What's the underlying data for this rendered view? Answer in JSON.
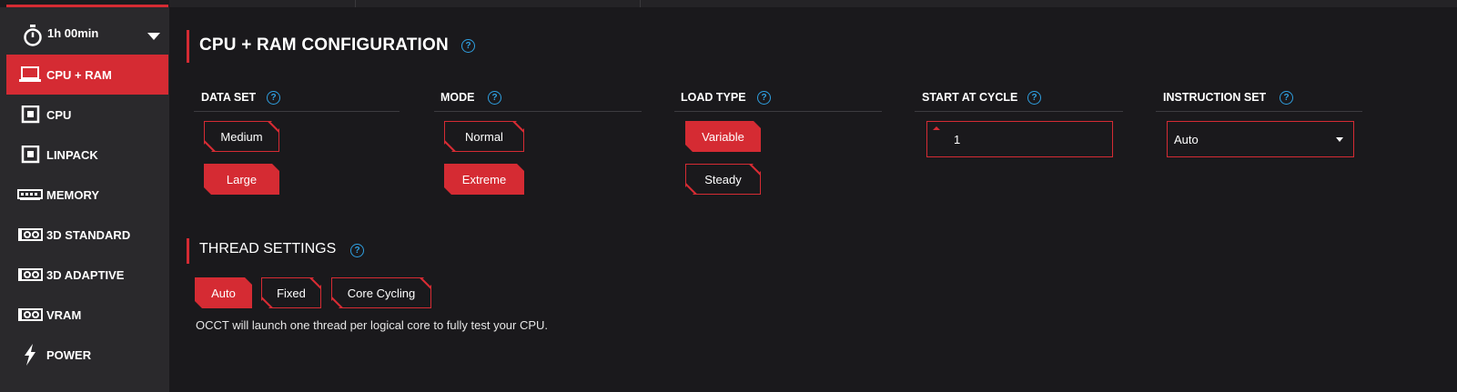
{
  "timer": {
    "label": "1h 00min"
  },
  "sidebar": {
    "items": [
      {
        "label": "CPU + RAM",
        "icon": "laptop-icon",
        "active": true
      },
      {
        "label": "CPU",
        "icon": "chip-icon",
        "active": false
      },
      {
        "label": "LINPACK",
        "icon": "chip-icon",
        "active": false
      },
      {
        "label": "MEMORY",
        "icon": "memory-icon",
        "active": false
      },
      {
        "label": "3D STANDARD",
        "icon": "gpu-icon",
        "active": false
      },
      {
        "label": "3D ADAPTIVE",
        "icon": "gpu-icon",
        "active": false
      },
      {
        "label": "VRAM",
        "icon": "gpu-icon",
        "active": false
      },
      {
        "label": "POWER",
        "icon": "lightning-icon",
        "active": false
      }
    ]
  },
  "config": {
    "title": "CPU + RAM CONFIGURATION",
    "data_set": {
      "label": "DATA SET",
      "options": [
        "Medium",
        "Large"
      ],
      "selected": "Large"
    },
    "mode": {
      "label": "MODE",
      "options": [
        "Normal",
        "Extreme"
      ],
      "selected": "Extreme"
    },
    "load_type": {
      "label": "LOAD TYPE",
      "options": [
        "Variable",
        "Steady"
      ],
      "selected": "Variable"
    },
    "start_cycle": {
      "label": "START AT CYCLE",
      "value": "1"
    },
    "instruction_set": {
      "label": "INSTRUCTION SET",
      "value": "Auto"
    }
  },
  "threads": {
    "title": "THREAD SETTINGS",
    "options": [
      "Auto",
      "Fixed",
      "Core Cycling"
    ],
    "selected": "Auto",
    "description": "OCCT will launch one thread per logical core to fully test your CPU."
  },
  "colors": {
    "accent": "#d52b33",
    "help": "#2f9fe0",
    "background": "#1a191c",
    "sidebar": "#2a292c"
  }
}
